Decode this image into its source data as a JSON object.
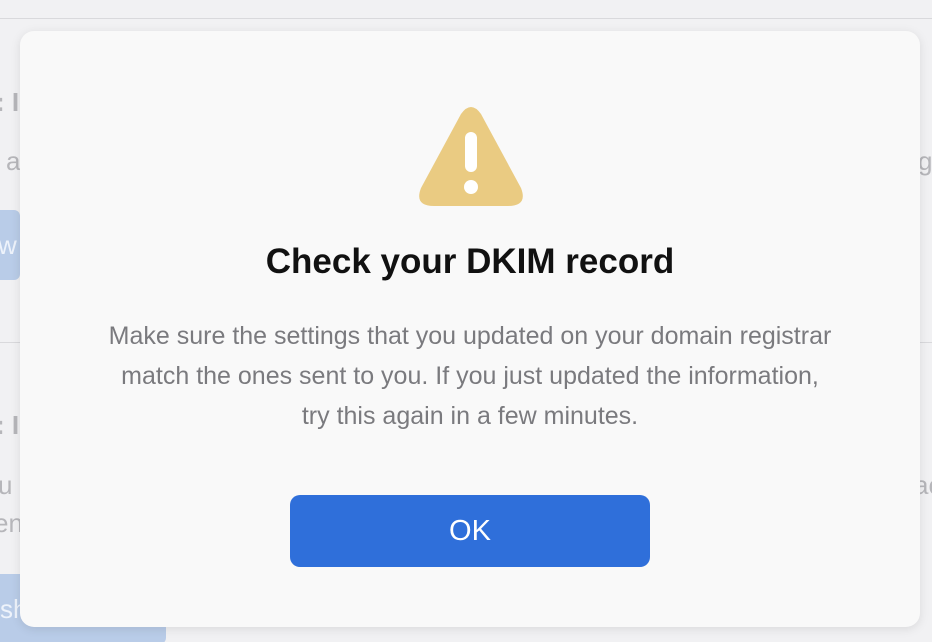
{
  "background": {
    "fragments": [
      ": I",
      "a",
      "w",
      "g",
      ": I",
      "u",
      "en",
      "ac",
      "sh"
    ]
  },
  "dialog": {
    "icon": "warning-triangle-icon",
    "icon_color": "#EACB82",
    "title": "Check your DKIM record",
    "message": "Make sure the settings that you updated on your domain registrar match the ones sent to you. If you just updated the information, try this again in a few minutes.",
    "ok_label": "OK",
    "ok_color": "#2F6FDA"
  }
}
